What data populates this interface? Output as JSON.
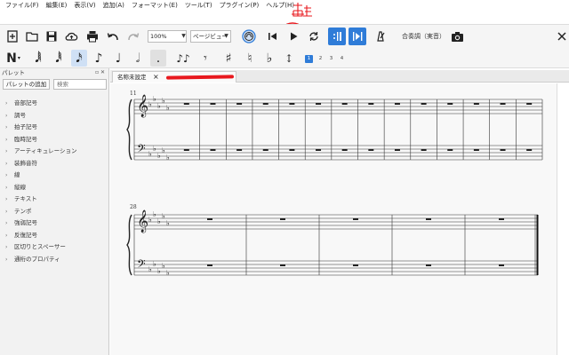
{
  "menu": [
    "ファイル(F)",
    "編集(E)",
    "表示(V)",
    "追加(A)",
    "フォーマット(E)",
    "ツール(T)",
    "プラグイン(P)",
    "ヘルプ(H)"
  ],
  "annotation": {
    "text": "再生",
    "color": "#e8181e"
  },
  "toolbar": {
    "zoom": "100%",
    "view_mode": "ページビュー",
    "concert_pitch": "合奏調（実音）"
  },
  "notebar": {
    "voices": [
      "1",
      "2",
      "3",
      "4"
    ],
    "active_voice": "1"
  },
  "palette": {
    "title": "パレット",
    "add_button": "パレットの追加",
    "search_placeholder": "検索",
    "items": [
      "音部記号",
      "調号",
      "拍子記号",
      "臨時記号",
      "アーティキュレーション",
      "装飾音符",
      "線",
      "縦線",
      "テキスト",
      "テンポ",
      "強弱記号",
      "反復記号",
      "区切りとスペーサー",
      "通桁のプロパティ"
    ]
  },
  "tab": {
    "label": "名称未設定"
  },
  "score": {
    "system1_measure_number": "11",
    "system2_measure_number": "28",
    "accent_color": "#2f7cd8"
  }
}
